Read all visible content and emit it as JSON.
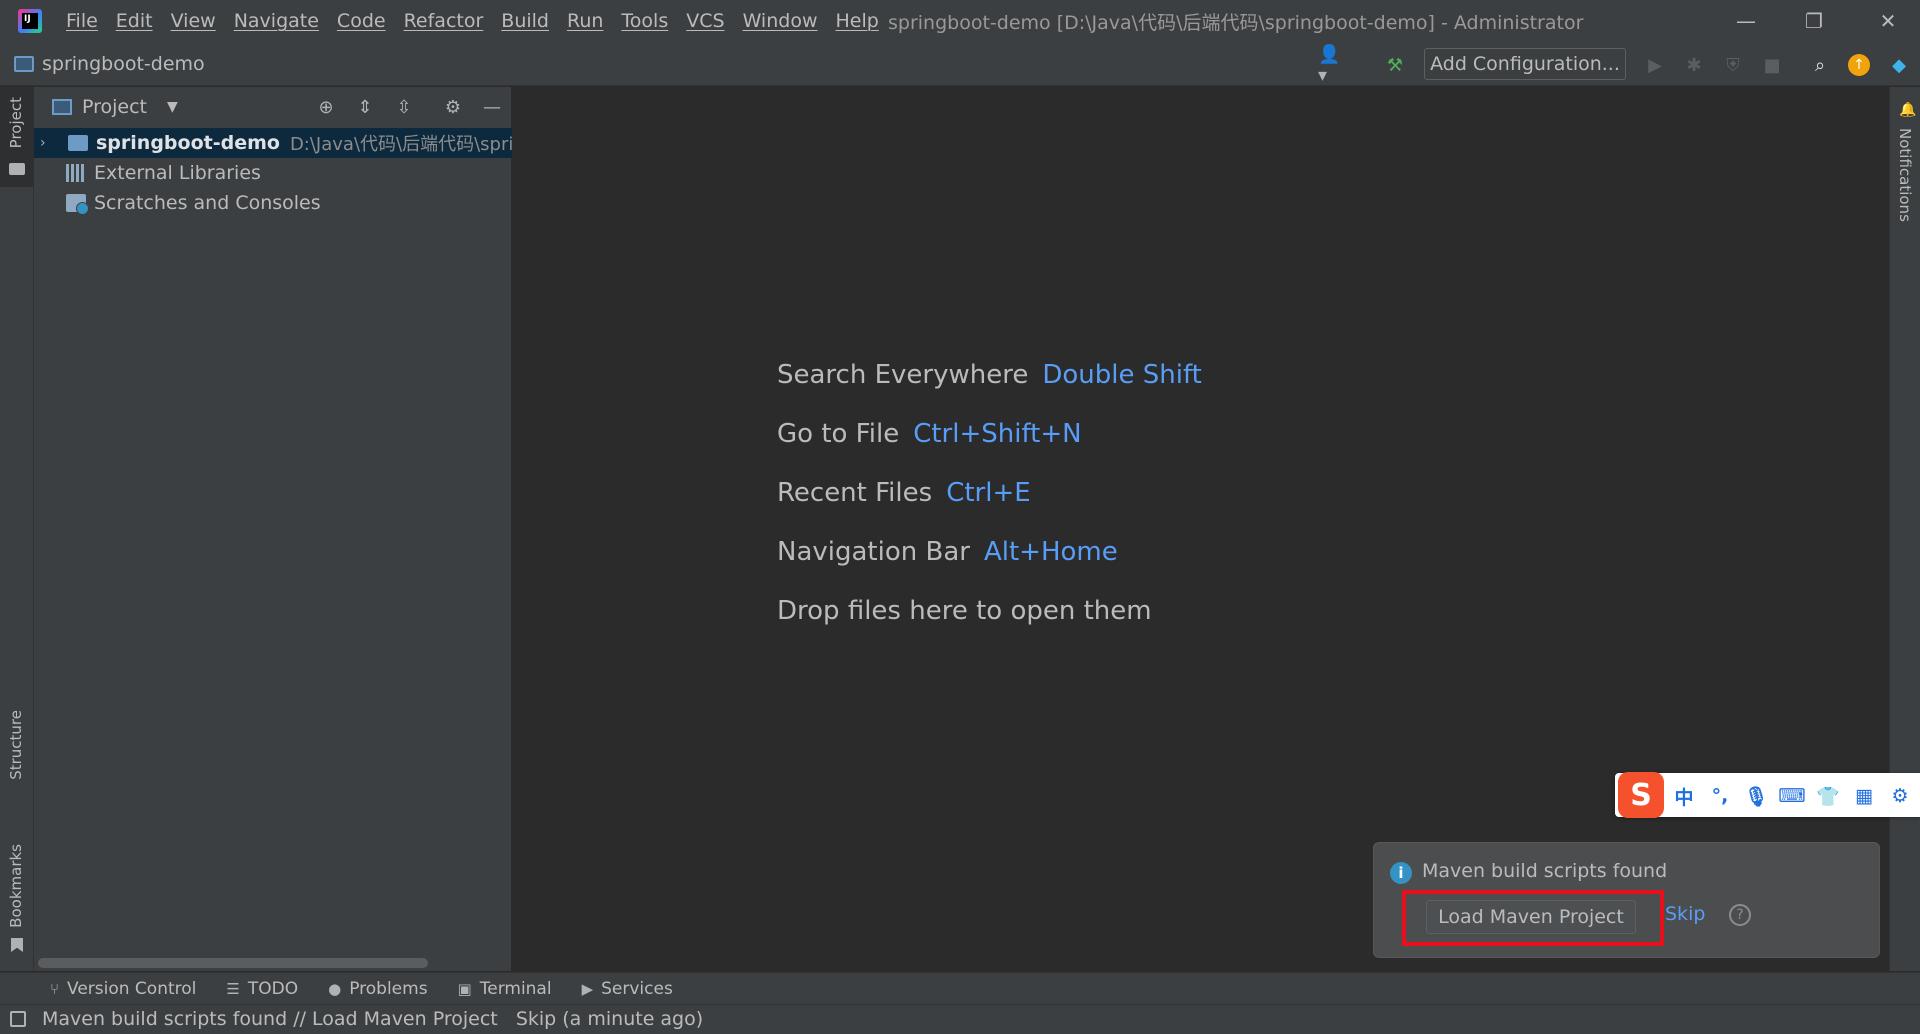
{
  "title_bar": {
    "menus": [
      "File",
      "Edit",
      "View",
      "Navigate",
      "Code",
      "Refactor",
      "Build",
      "Run",
      "Tools",
      "VCS",
      "Window",
      "Help"
    ],
    "window_title": "springboot-demo [D:\\Java\\代码\\后端代码\\springboot-demo] - Administrator"
  },
  "navbar": {
    "project_name": "springboot-demo",
    "add_configuration": "Add Configuration..."
  },
  "left_strip": {
    "project_tab": "Project",
    "structure_tab": "Structure",
    "bookmarks_tab": "Bookmarks"
  },
  "project_panel": {
    "title": "Project",
    "tree": [
      {
        "name": "springboot-demo",
        "path": "D:\\Java\\代码\\后端代码\\spring"
      },
      {
        "name": "External Libraries"
      },
      {
        "name": "Scratches and Consoles"
      }
    ]
  },
  "editor_hints": [
    {
      "label": "Search Everywhere",
      "shortcut": "Double Shift"
    },
    {
      "label": "Go to File",
      "shortcut": "Ctrl+Shift+N"
    },
    {
      "label": "Recent Files",
      "shortcut": "Ctrl+E"
    },
    {
      "label": "Navigation Bar",
      "shortcut": "Alt+Home"
    },
    {
      "label": "Drop files here to open them",
      "shortcut": ""
    }
  ],
  "right_strip": {
    "notifications_tab": "Notifications"
  },
  "ime_toolbar": {
    "logo": "S",
    "mode": "中",
    "punct": "°,"
  },
  "notification": {
    "title": "Maven build scripts found",
    "action": "Load Maven Project",
    "skip": "Skip",
    "help": "?"
  },
  "bottom_tabs": [
    "Version Control",
    "TODO",
    "Problems",
    "Terminal",
    "Services"
  ],
  "status_bar": {
    "message": "Maven build scripts found // Load Maven Project   Skip (a minute ago)"
  },
  "colors": {
    "accent_link": "#589df6",
    "highlight_box": "#e8101c",
    "background": "#2b2b2b",
    "panel": "#3c3f41"
  }
}
